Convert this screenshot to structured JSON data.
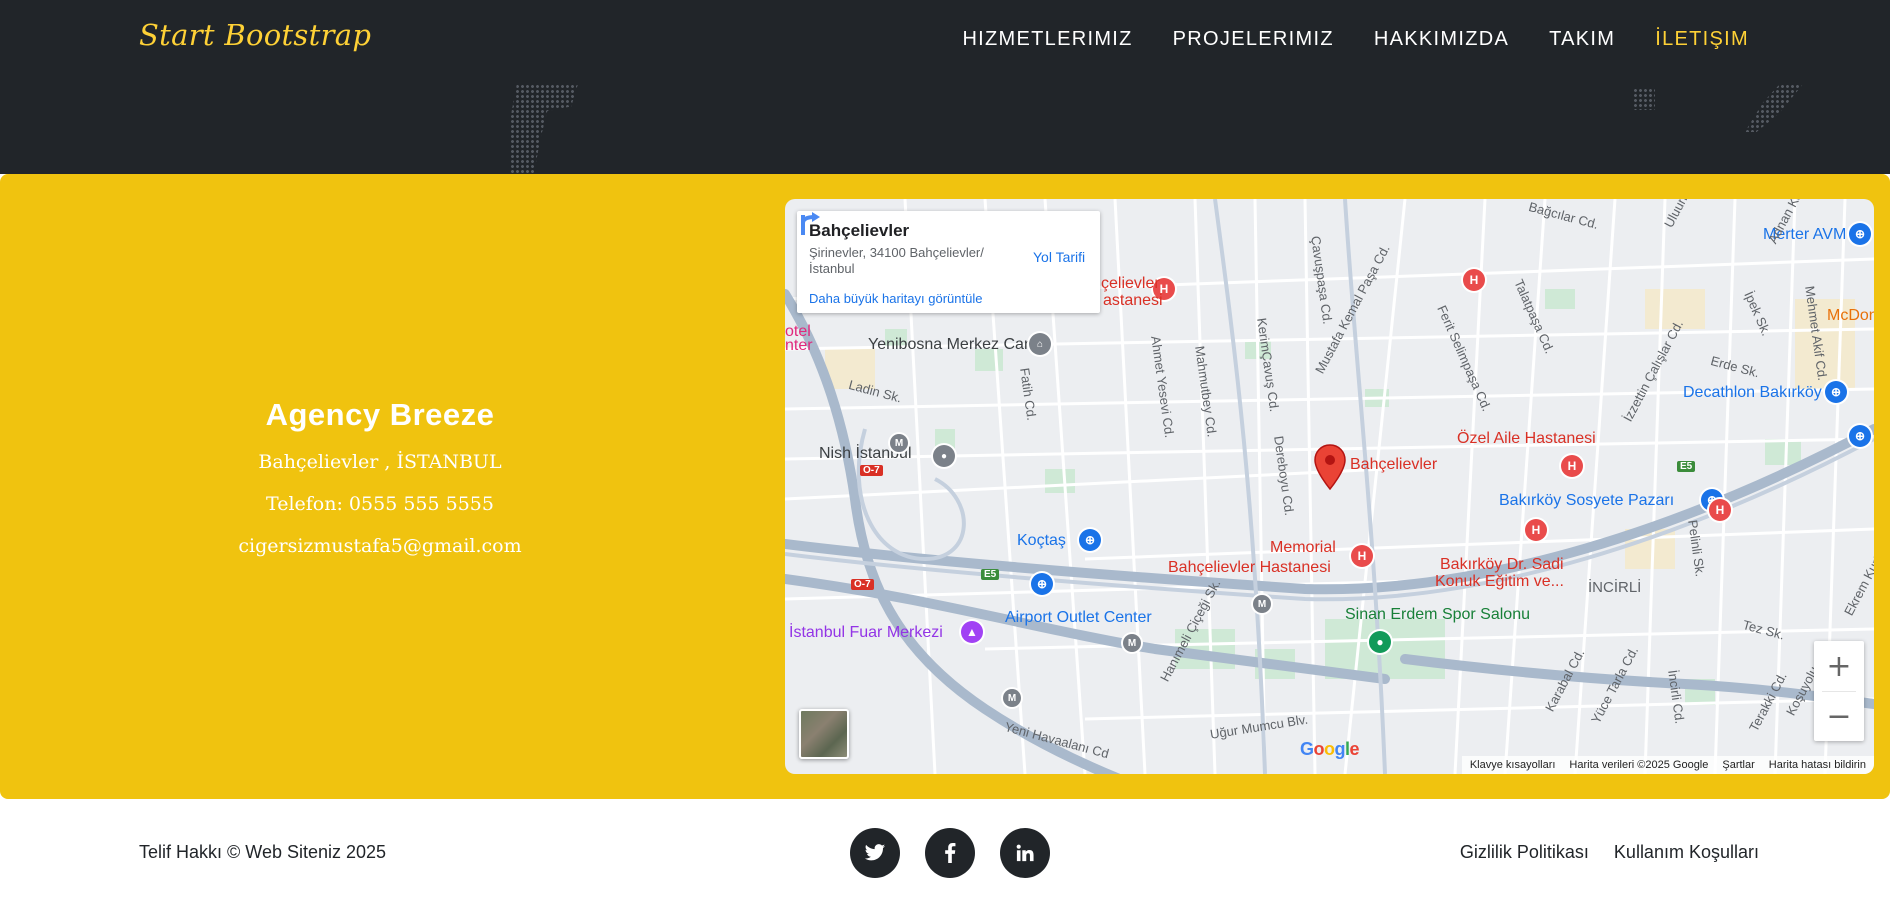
{
  "header": {
    "brand": "Start Bootstrap",
    "nav": [
      "HIZMETLERIMIZ",
      "PROJELERIMIZ",
      "HAKKIMIZDA",
      "TAKIM",
      "İLETIŞIM"
    ],
    "active_nav": "İLETIŞIM",
    "bg_color": "#212529",
    "accent_color": "#fed136"
  },
  "contact": {
    "bg_color": "#f0c30f",
    "name": "Agency Breeze",
    "address": "Bahçelievler , İSTANBUL",
    "phone": "Telefon: 0555 555 5555",
    "email": "cigersizmustafa5@gmail.com"
  },
  "map": {
    "card": {
      "title": "Bahçelievler",
      "address": "Şirinevler, 34100 Bahçelievler/ İstanbul",
      "larger_map_link": "Daha büyük haritayı görüntüle",
      "directions_label": "Yol Tarifi"
    },
    "marker_label": "Bahçelievler",
    "places": {
      "cami": "Yenibosna Merkez Camii",
      "nish": "Nish İstanbul",
      "koctas": "Koçtaş",
      "airport_outlet": "Airport Outlet Center",
      "fuar": "İstanbul Fuar Merkezi",
      "memorial_1": "Memorial",
      "memorial_2": "Bahçelievler Hastanesi",
      "ozel": "Özel Aile Hastanesi",
      "sosyete": "Bakırköy Sosyete Pazarı",
      "decathlon": "Decathlon Bakırköy",
      "merter": "Merter AVM",
      "mcdon": "McDon",
      "bakirkoy_dr_1": "Bakırköy Dr. Sadi",
      "bakirkoy_dr_2": "Konuk Eğitim ve...",
      "incirli": "İNCİRLİ",
      "sinan": "Sinan Erdem Spor Salonu",
      "bah_hast_1": "çelievler",
      "bah_hast_2": "astanesi",
      "otel_1": "otel",
      "otel_2": "nter"
    },
    "streets": {
      "ladin": "Ladin Sk.",
      "fatih": "Fatih Cd.",
      "ahmet": "Ahmet Yesevi Cd.",
      "mahmut": "Mahmutbey Cd.",
      "kerim": "KerimÇavuş Cd.",
      "dereboyu": "Dereboyu Cd.",
      "cavus": "Çavuşpaşa Cd.",
      "mustafa": "Mustafa Kemal Paşa Cd.",
      "ferit": "Ferit Selimpaşa Cd.",
      "talatpasa": "Talatpaşa Cd.",
      "izzettin": "İzzettin Çalışlar Cd.",
      "sagcilar": "Bağcılar Cd.",
      "adnan": "Adnan Kahve",
      "ipek": "İpek Sk.",
      "mehmet": "Mehmet Akif Cd.",
      "erde": "Erde Sk.",
      "tez": "Tez Sk.",
      "kosuyolu": "Koşuyolu Cd.",
      "ekrem": "Ekrem Kurt Bl.",
      "hanimeli": "Hanımeli Çiçeği Sk.",
      "ugur": "Uğur Mumcu Blv.",
      "yeni": "Yeni Havaalanı Cd",
      "karabal": "Karabal Cd.",
      "yuce": "Yüce Tarla Cd.",
      "incirli_cd": "İncirli Cd.",
      "terakki": "Terakki Cd.",
      "pelinli": "Pelinli Sk.",
      "ulunal": "Uluunal Cd."
    },
    "highway_badges": [
      "O-7",
      "O-7",
      "E5",
      "E5"
    ],
    "zoom_in": "+",
    "zoom_out": "−",
    "google_logo": [
      "G",
      "o",
      "o",
      "g",
      "l",
      "e"
    ],
    "google_colors": [
      "#4285F4",
      "#EA4335",
      "#FBBC05",
      "#4285F4",
      "#34A853",
      "#EA4335"
    ],
    "attribution": [
      "Klavye kısayolları",
      "Harita verileri ©2025 Google",
      "Şartlar",
      "Harita hatası bildirin"
    ]
  },
  "footer": {
    "copyright": "Telif Hakkı © Web Siteniz 2025",
    "social_icons": [
      "twitter-icon",
      "facebook-icon",
      "linkedin-icon"
    ],
    "links": [
      "Gizlilik Politikası",
      "Kullanım Koşulları"
    ]
  }
}
